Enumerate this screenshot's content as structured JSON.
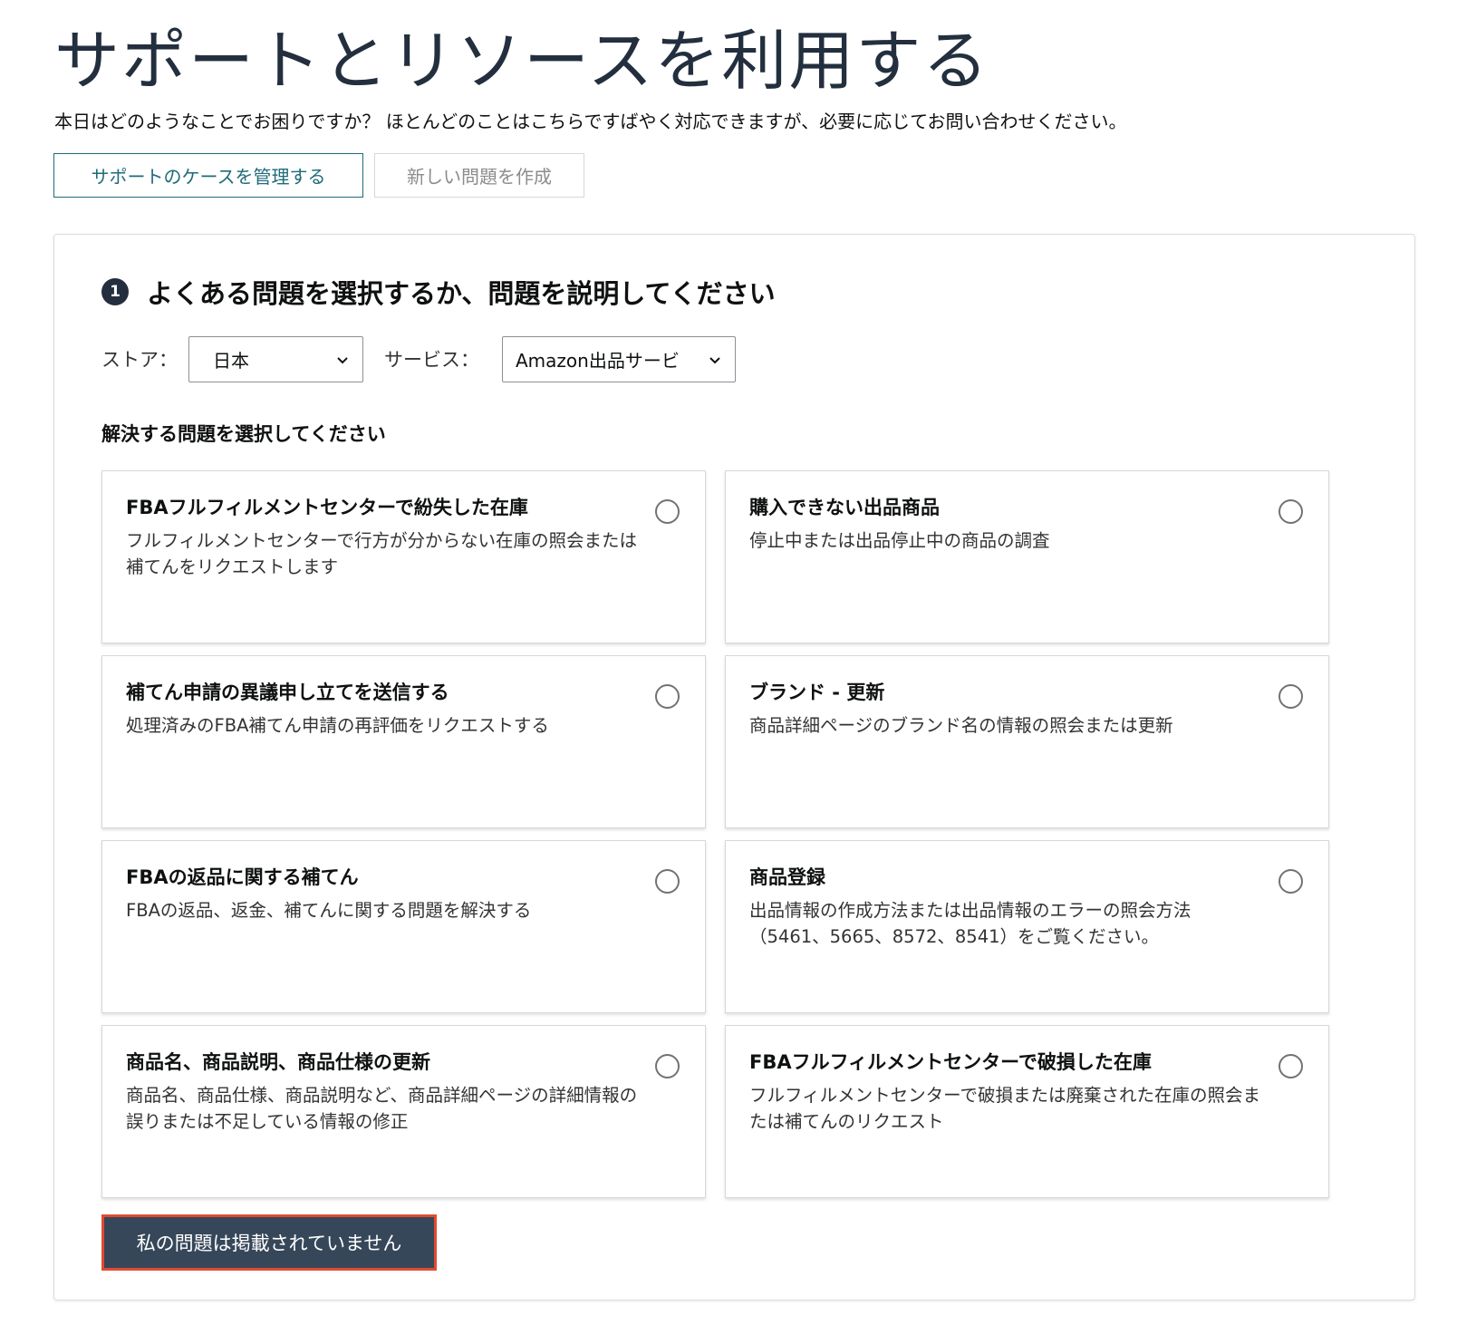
{
  "header": {
    "title": "サポートとリソースを利用する",
    "subtitle": "本日はどのようなことでお困りですか？ ほとんどのことはこちらですばやく対応できますが、必要に応じてお問い合わせください。",
    "manage_cases_label": "サポートのケースを管理する",
    "new_issue_label": "新しい問題を作成"
  },
  "step": {
    "number": "1",
    "title": "よくある問題を選択するか、問題を説明してください"
  },
  "filters": {
    "store_label": "ストア：",
    "store_value": "日本",
    "service_label": "サービス：",
    "service_value": "Amazon出品サービ"
  },
  "issues_heading": "解決する問題を選択してください",
  "issues": [
    {
      "title": "FBAフルフィルメントセンターで紛失した在庫",
      "desc": "フルフィルメントセンターで行方が分からない在庫の照会または補てんをリクエストします"
    },
    {
      "title": "購入できない出品商品",
      "desc": "停止中または出品停止中の商品の調査"
    },
    {
      "title": "補てん申請の異議申し立てを送信する",
      "desc": "処理済みのFBA補てん申請の再評価をリクエストする"
    },
    {
      "title": "ブランド - 更新",
      "desc": "商品詳細ページのブランド名の情報の照会または更新"
    },
    {
      "title": "FBAの返品に関する補てん",
      "desc": "FBAの返品、返金、補てんに関する問題を解決する"
    },
    {
      "title": "商品登録",
      "desc": "出品情報の作成方法または出品情報のエラーの照会方法（5461、5665、8572、8541）をご覧ください。"
    },
    {
      "title": "商品名、商品説明、商品仕様の更新",
      "desc": "商品名、商品仕様、商品説明など、商品詳細ページの詳細情報の誤りまたは不足している情報の修正"
    },
    {
      "title": "FBAフルフィルメントセンターで破損した在庫",
      "desc": "フルフィルメントセンターで破損または廃棄された在庫の照会または補てんのリクエスト"
    }
  ],
  "not_listed_label": "私の問題は掲載されていません",
  "colors": {
    "dark": "#232f3e",
    "accent_teal": "#1f6b7a",
    "button_dark": "#37475a",
    "highlight_red": "#e14b2f"
  }
}
